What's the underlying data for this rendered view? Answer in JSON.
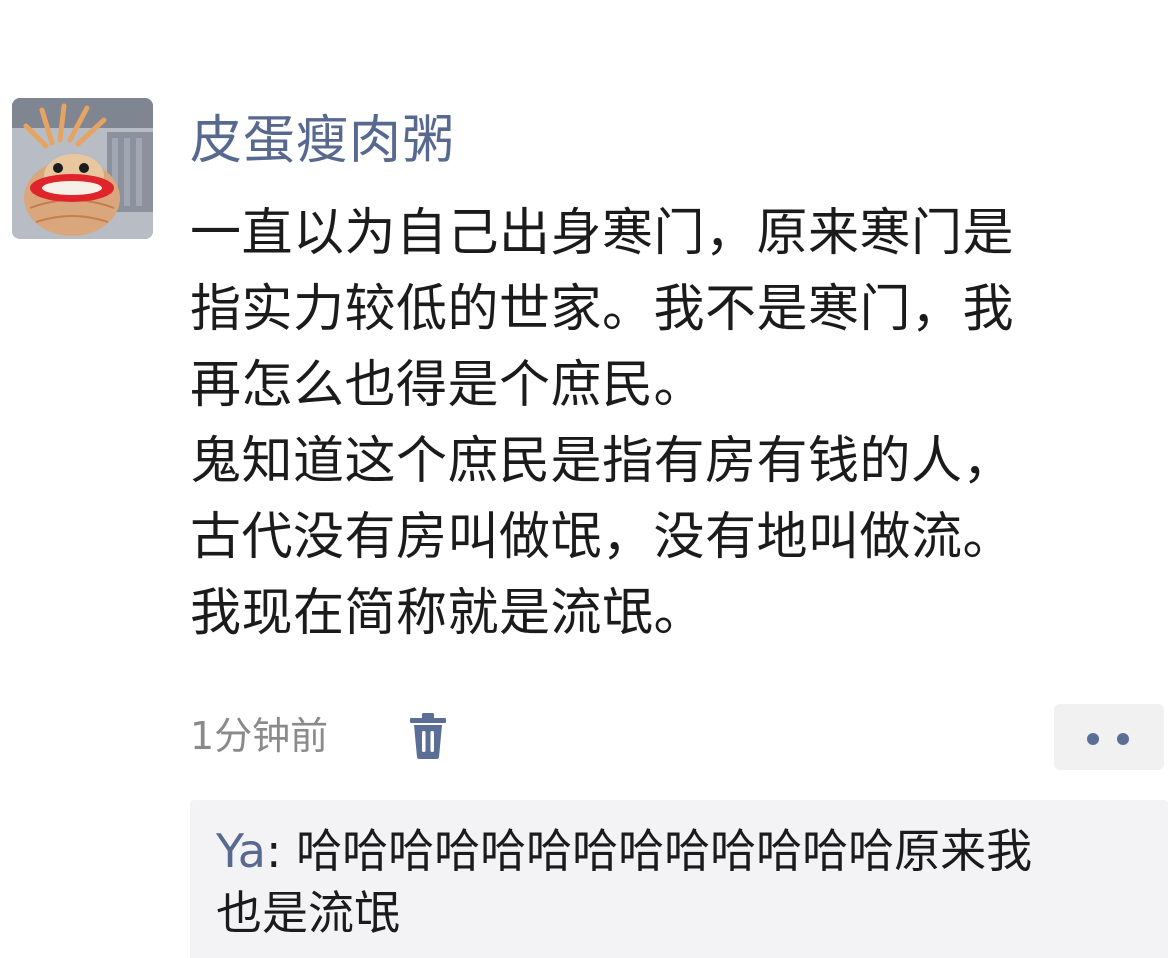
{
  "post": {
    "author": "皮蛋瘦肉粥",
    "lines": [
      "一直以为自己出身寒门，原来寒门是",
      "指实力较低的世家。我不是寒门，我",
      "再怎么也得是个庶民。",
      "鬼知道这个庶民是指有房有钱的人，",
      "古代没有房叫做氓，没有地叫做流。",
      "我现在简称就是流氓。"
    ],
    "timestamp": "1分钟前",
    "delete_icon": "trash-icon",
    "more_icon": "more-dots-icon"
  },
  "comments": [
    {
      "user": "Ya",
      "separator": ": ",
      "text_line1": "哈哈哈哈哈哈哈哈哈哈哈哈哈原来我",
      "text_line2": "也是流氓"
    }
  ],
  "colors": {
    "name_link": "#57698f",
    "body_text": "#1b1b1b",
    "meta_text": "#8a8a8a",
    "comment_bg": "#f3f3f5"
  }
}
